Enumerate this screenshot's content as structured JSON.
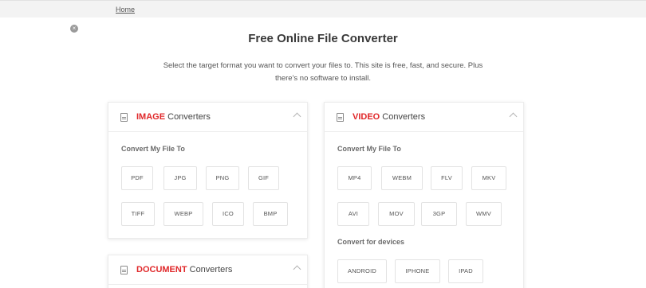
{
  "breadcrumb": {
    "home": "Home"
  },
  "header": {
    "title": "Free Online File Converter",
    "subtitle_line1": "Select the target format you want to convert your files to. This site is free, fast, and secure. Plus",
    "subtitle_line2": "there's no software to install."
  },
  "image_card": {
    "highlight": "IMAGE",
    "rest": " Converters",
    "section": "Convert My File To",
    "formats": [
      "PDF",
      "JPG",
      "PNG",
      "GIF",
      "TIFF",
      "WEBP",
      "ICO",
      "BMP"
    ]
  },
  "video_card": {
    "highlight": "VIDEO",
    "rest": " Converters",
    "section": "Convert My File To",
    "formats": [
      "MP4",
      "WEBM",
      "FLV",
      "MKV",
      "AVI",
      "MOV",
      "3GP",
      "WMV"
    ],
    "devices_section": "Convert for devices",
    "devices": [
      "ANDROID",
      "IPHONE",
      "IPAD"
    ]
  },
  "document_card": {
    "highlight": "DOCUMENT",
    "rest": " Converters"
  },
  "colors": {
    "accent": "#e0282a"
  }
}
